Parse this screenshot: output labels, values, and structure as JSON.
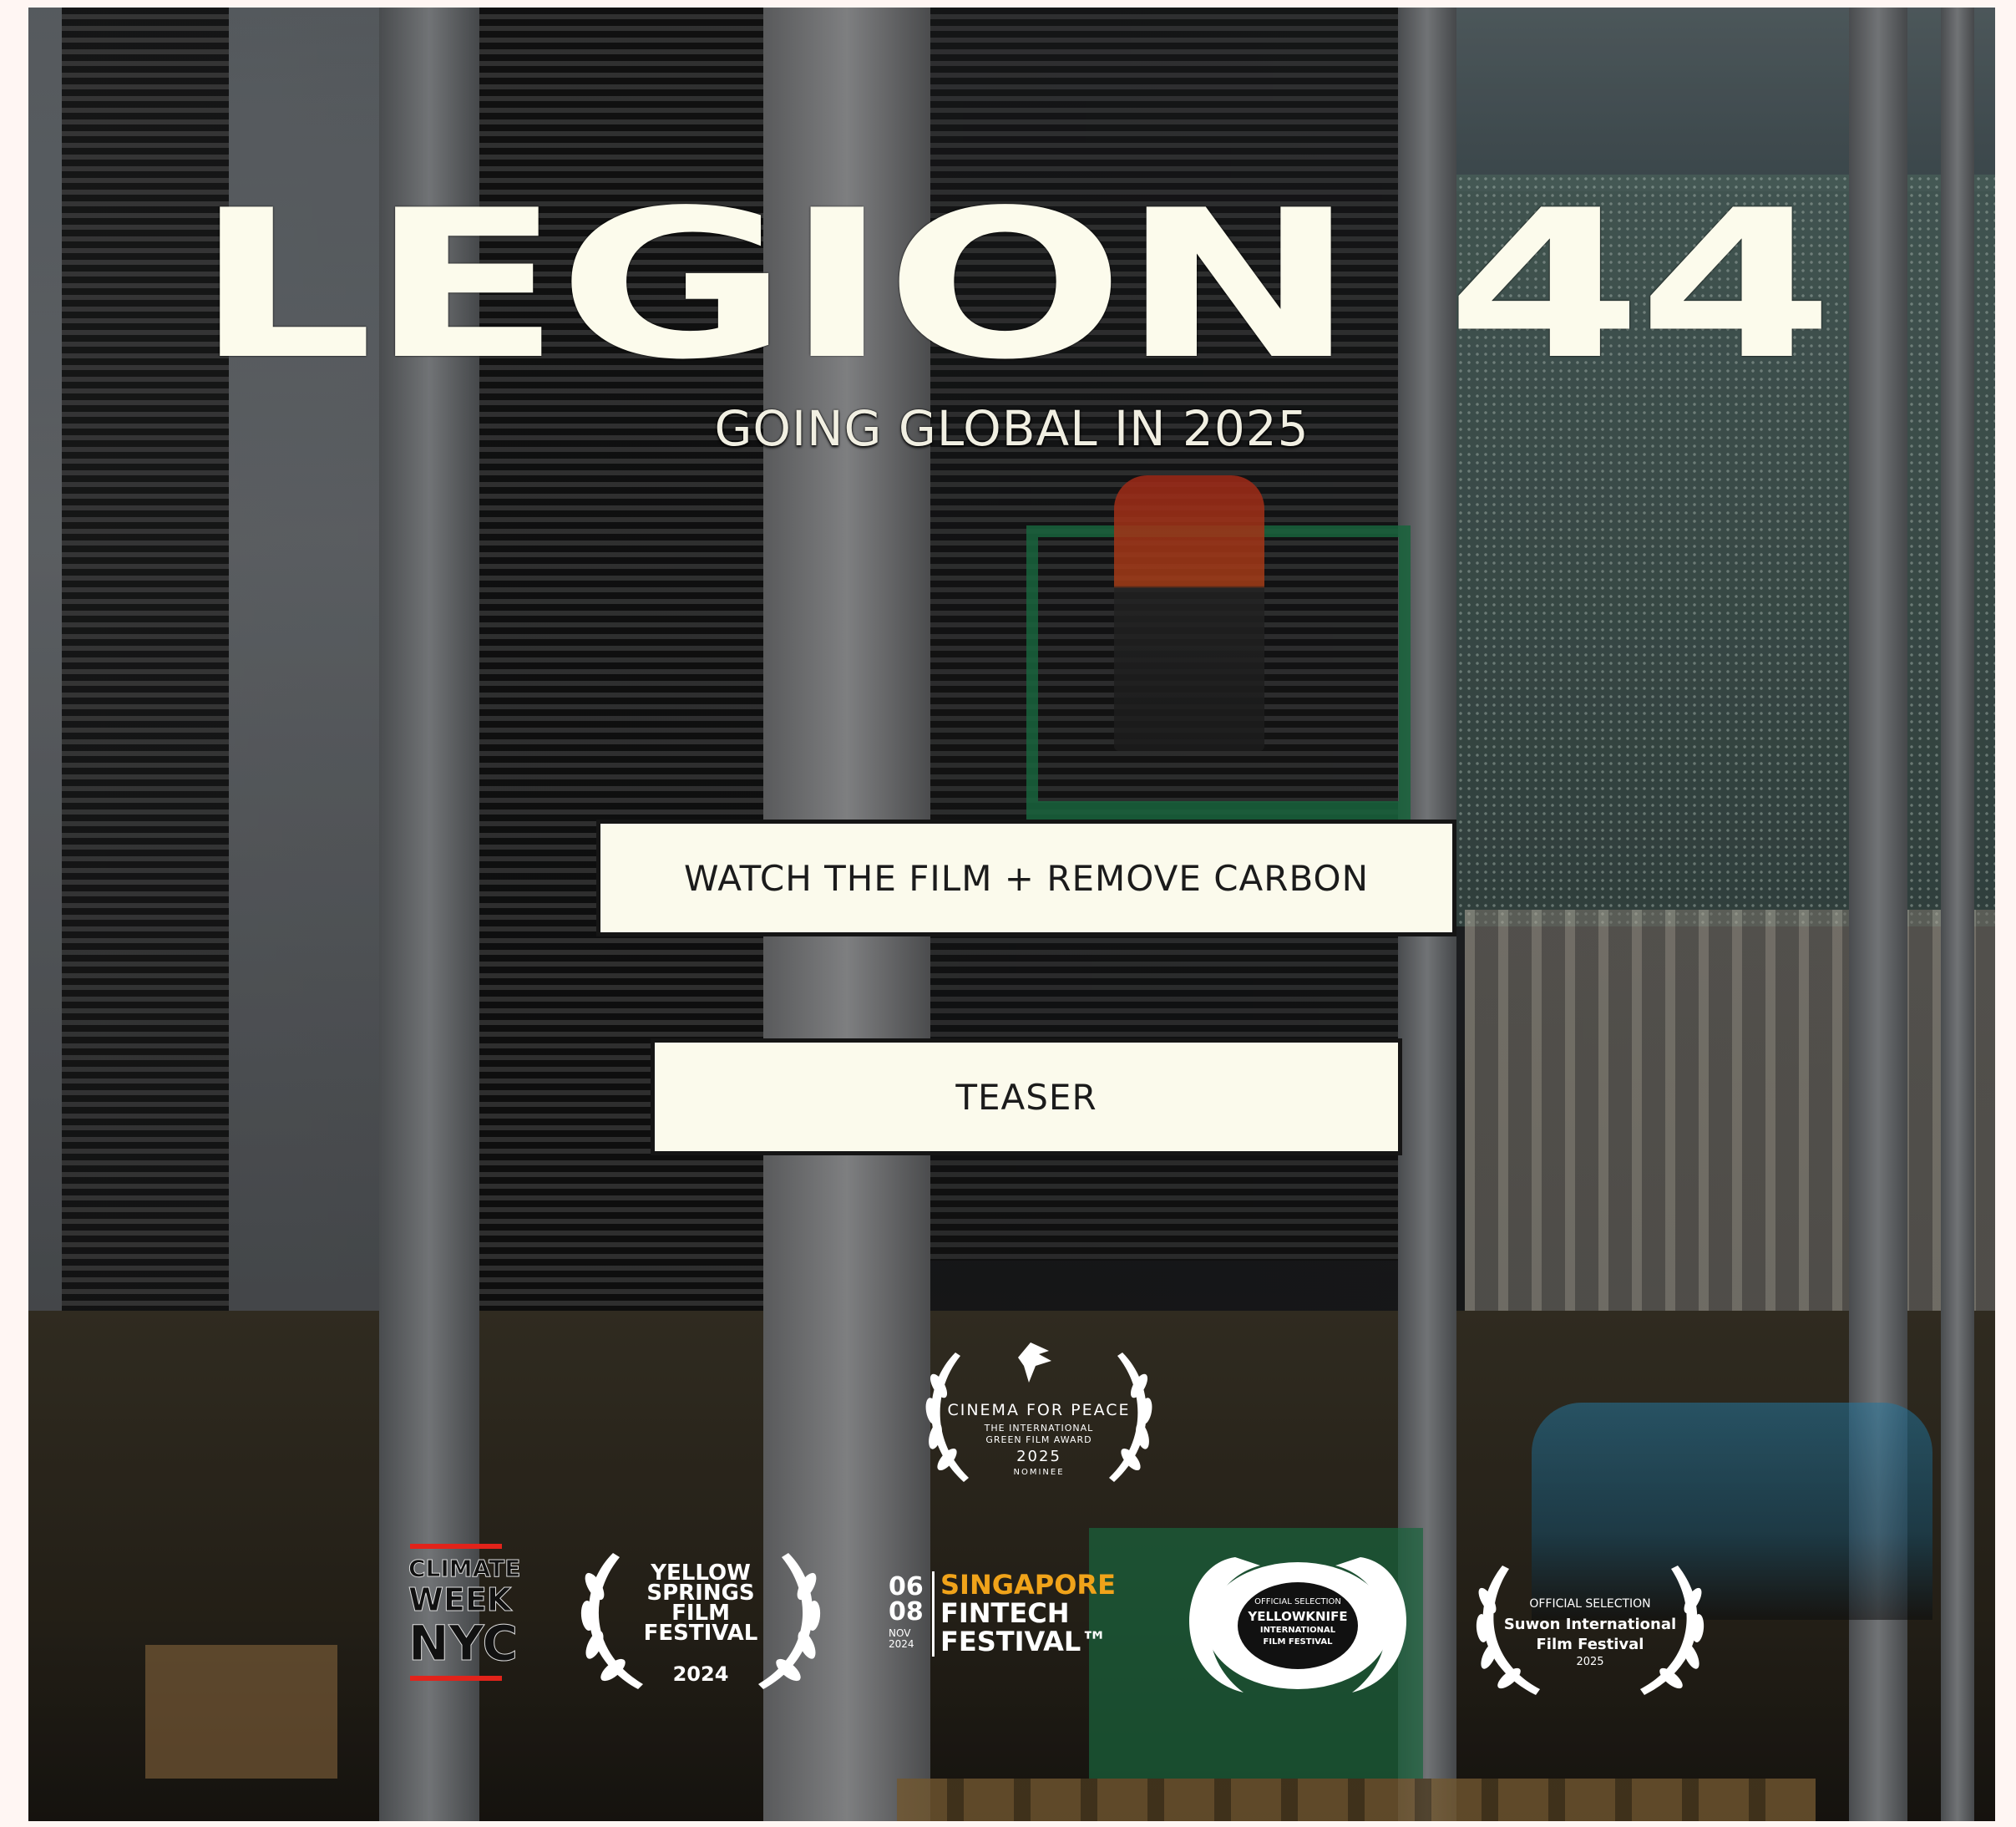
{
  "hero": {
    "title": "LEGION 44",
    "subtitle": "GOING GLOBAL IN 2025"
  },
  "buttons": {
    "watch_label": "WATCH THE FILM + REMOVE CARBON",
    "teaser_label": "TEASER"
  },
  "laurels": {
    "cinema": {
      "name": "CINEMA FOR PEACE",
      "line1": "THE INTERNATIONAL",
      "line2": "GREEN FILM AWARD",
      "year": "2025",
      "status": "NOMINEE"
    },
    "climate": {
      "line1": "CLIMATE",
      "line2": "WEEK",
      "line3": "NYC"
    },
    "yellow_springs": {
      "line1": "YELLOW",
      "line2": "SPRINGS",
      "line3": "FILM",
      "line4": "FESTIVAL",
      "year": "2024"
    },
    "fintech": {
      "date1": "06",
      "date2": "08",
      "month_year": "NOV 2024",
      "line1": "SINGAPORE",
      "line2": "FINTECH",
      "line3": "FESTIVAL™"
    },
    "yellowknife": {
      "line1": "OFFICIAL SELECTION",
      "line2": "YELLOWKNIFE",
      "line3": "INTERNATIONAL",
      "line4": "FILM FESTIVAL"
    },
    "suwon": {
      "line1": "OFFICIAL SELECTION",
      "line2": "Suwon International",
      "line3": "Film Festival",
      "year": "2025"
    }
  },
  "colors": {
    "title": "#fcfbec",
    "button_bg": "#fbfaec",
    "button_border": "#151515",
    "fintech_accent": "#f0a31a",
    "climate_red": "#e2231a"
  }
}
